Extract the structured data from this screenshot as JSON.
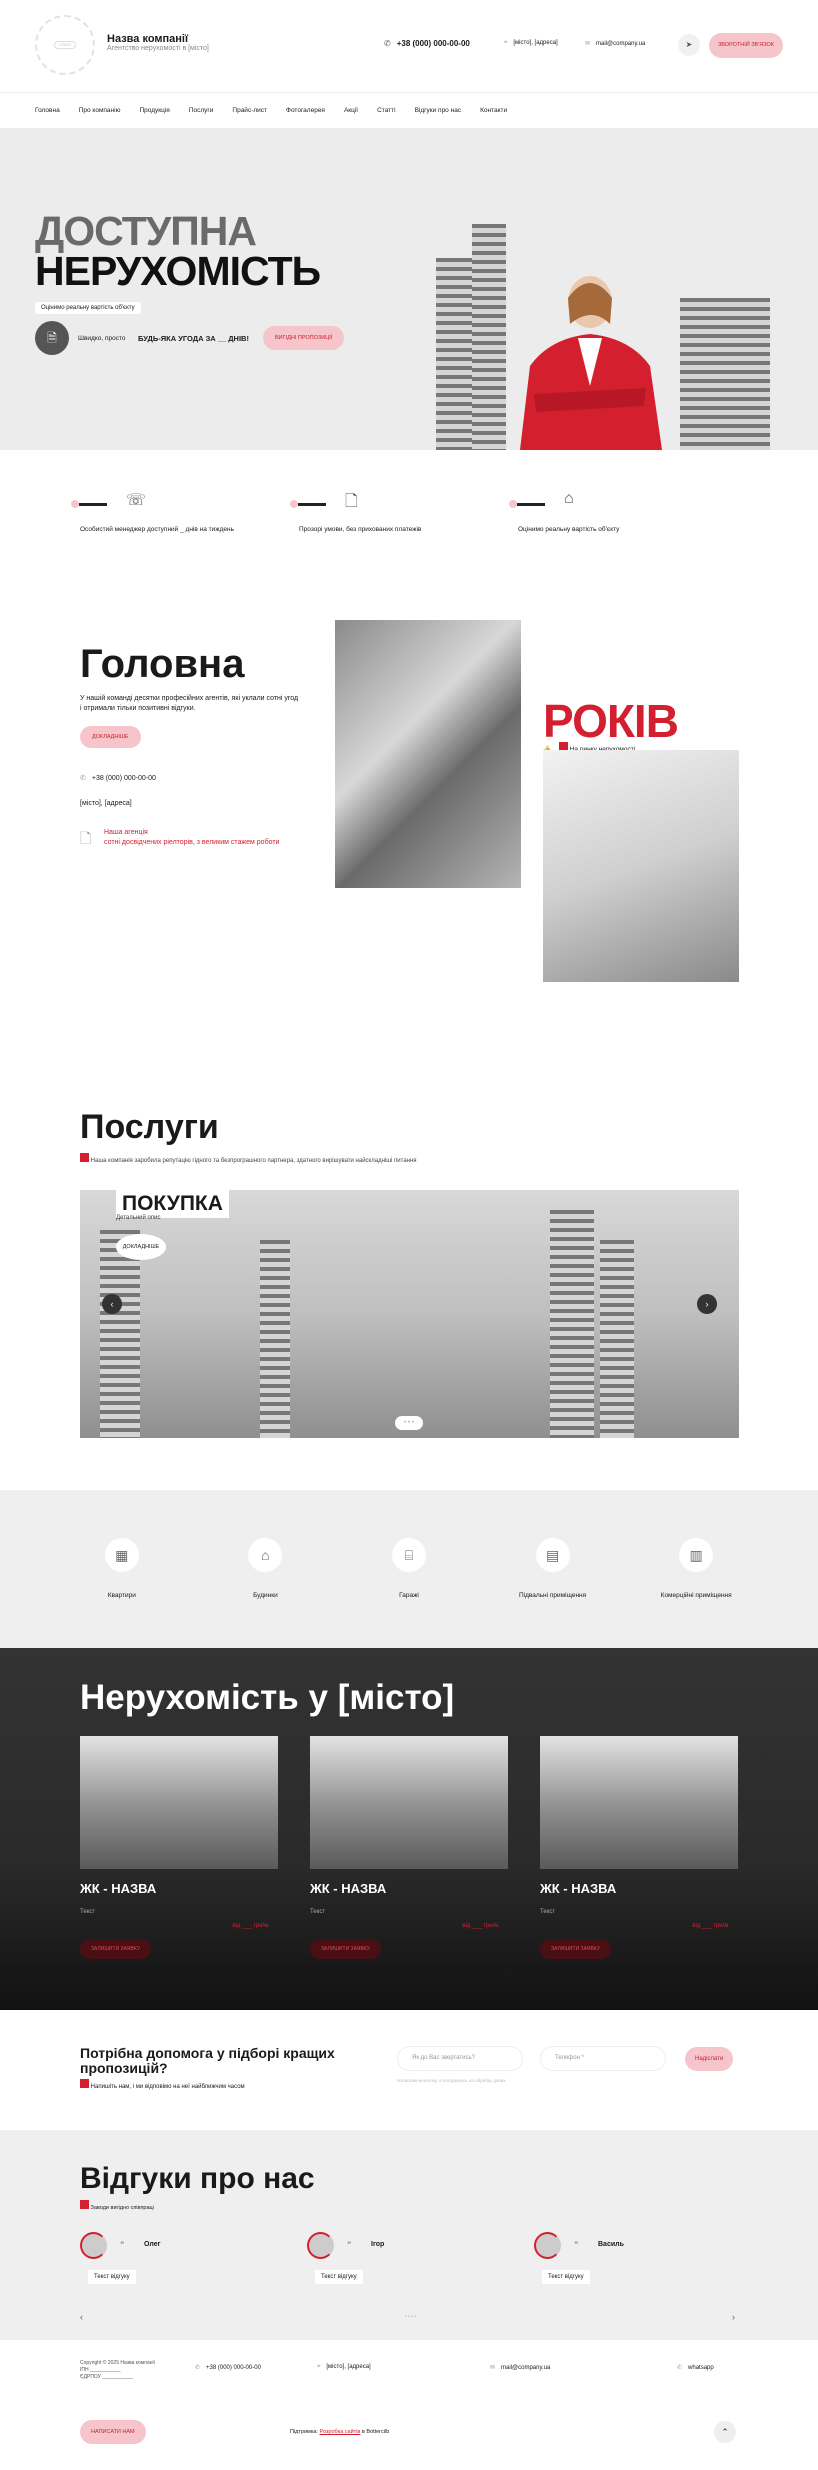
{
  "header": {
    "logo_text": "LOGO",
    "company_name": "Назва компанії",
    "company_sub": "Агентство нерухомості в [місто]",
    "phone": "+38 (000) 000-00-00",
    "address": "[місто], [адреса]",
    "email": "mail@company.ua",
    "callback_label": "ЗВОРОТНІЙ ЗВ'ЯЗОК"
  },
  "nav": [
    "Головна",
    "Про компанію",
    "Продукція",
    "Послуги",
    "Прайс-лист",
    "Фотогалерея",
    "Акції",
    "Статті",
    "Відгуки про нас",
    "Контакти"
  ],
  "hero": {
    "title_line1": "ДОСТУПНА",
    "title_line2": "НЕРУХОМІСТЬ",
    "tag": "Оцінимо реальну вартість об'єкту",
    "fast": "Швидко, просто",
    "deal": "БУДЬ-ЯКА УГОДА ЗА __ ДНІВ!",
    "offer_label": "ВИГІДНІ ПРОПОЗИЦІЇ"
  },
  "features": [
    {
      "text": "Особистий менеджер доступний _ днів на тиждень",
      "icon": "phone-icon"
    },
    {
      "text": "Прозорі умови, без прихованих платежів",
      "icon": "document-icon"
    },
    {
      "text": "Оцінимо реальну вартість об'єкту",
      "icon": "houses-icon"
    }
  ],
  "about": {
    "title": "Головна",
    "text": "У нашій команді десятки професійних агентів, які уклали сотні угод і отримали тільки позитивні відгуки.",
    "more_label": "ДОКЛАДНІШЕ",
    "phone": "+38 (000) 000-00-00",
    "address": "[місто], [адреса]",
    "agency_line1": "Наша агенція",
    "agency_line2": "сотні досвідчених ріелторів, з великим стажем роботи",
    "years": "РОКІВ",
    "years_sub": "На ринку нерухомості"
  },
  "services": {
    "title": "Послуги",
    "subtitle": "Наша компанія заробила репутацію гідного та безпрограшного партнера, здатного вирішувати найскладніші питання",
    "slide_title": "ПОКУПКА",
    "slide_sub": "Детальний опис",
    "slide_btn": "ДОКЛАДНІШЕ",
    "prev": "‹",
    "next": "›",
    "dots": "• • •"
  },
  "categories": [
    {
      "label": "Квартири",
      "icon": "apartment-icon"
    },
    {
      "label": "Будинки",
      "icon": "house-icon"
    },
    {
      "label": "Гаражі",
      "icon": "garage-icon"
    },
    {
      "label": "Підвальні приміщення",
      "icon": "basement-icon"
    },
    {
      "label": "Комерційні приміщення",
      "icon": "commercial-icon"
    }
  ],
  "listings": {
    "title": "Нерухомість у [місто]",
    "items": [
      {
        "name": "ЖК - НАЗВА",
        "text": "Текст",
        "price": "від ___ грн/м.",
        "btn": "ЗАЛИШИТИ ЗАЯВКУ"
      },
      {
        "name": "ЖК - НАЗВА",
        "text": "Текст",
        "price": "від ___ грн/м.",
        "btn": "ЗАЛИШИТИ ЗАЯВКУ"
      },
      {
        "name": "ЖК - НАЗВА",
        "text": "Текст",
        "price": "від ___ грн/м.",
        "btn": "ЗАЛИШИТИ ЗАЯВКУ"
      }
    ]
  },
  "help": {
    "title": "Потрібна допомога у підборі кращих пропозицій?",
    "subtitle": "Напишіть нам, і ми відповімо на неї найближчим часом",
    "name_placeholder": "Як до Вас звертатись?",
    "phone_placeholder": "Телефон *",
    "note": "Натискаючи кнопку, я погоджуюсь на обробку даних",
    "submit": "Надіслати"
  },
  "reviews": {
    "title": "Відгуки про нас",
    "subtitle": "Заводи вигідно співпраці",
    "items": [
      {
        "name": "Олег",
        "text": "Текст відгуку"
      },
      {
        "name": "Ігор",
        "text": "Текст відгуку"
      },
      {
        "name": "Василь",
        "text": "Текст відгуку"
      }
    ],
    "prev": "‹",
    "next": "›",
    "dots": "• • • •"
  },
  "footer": {
    "copyright": "Copyright © 2025 Назва компанії",
    "inn": "ІПН ___________",
    "edrpou": "ЄДРПОУ ___________",
    "phone": "+38 (000) 000-00-00",
    "address": "[місто], [адреса]",
    "email": "mail@company.ua",
    "whatsapp": "whatsapp",
    "write_label": "НАПИСАТИ НАМ",
    "dev_prefix": "Підтримка:",
    "dev_link": "Розробка сайтів",
    "dev_suffix": "в Bottercilb",
    "top": "⌃"
  },
  "colors": {
    "accent": "#d32030",
    "pill": "#f6c5cb",
    "dark": "#2b2b2b"
  }
}
